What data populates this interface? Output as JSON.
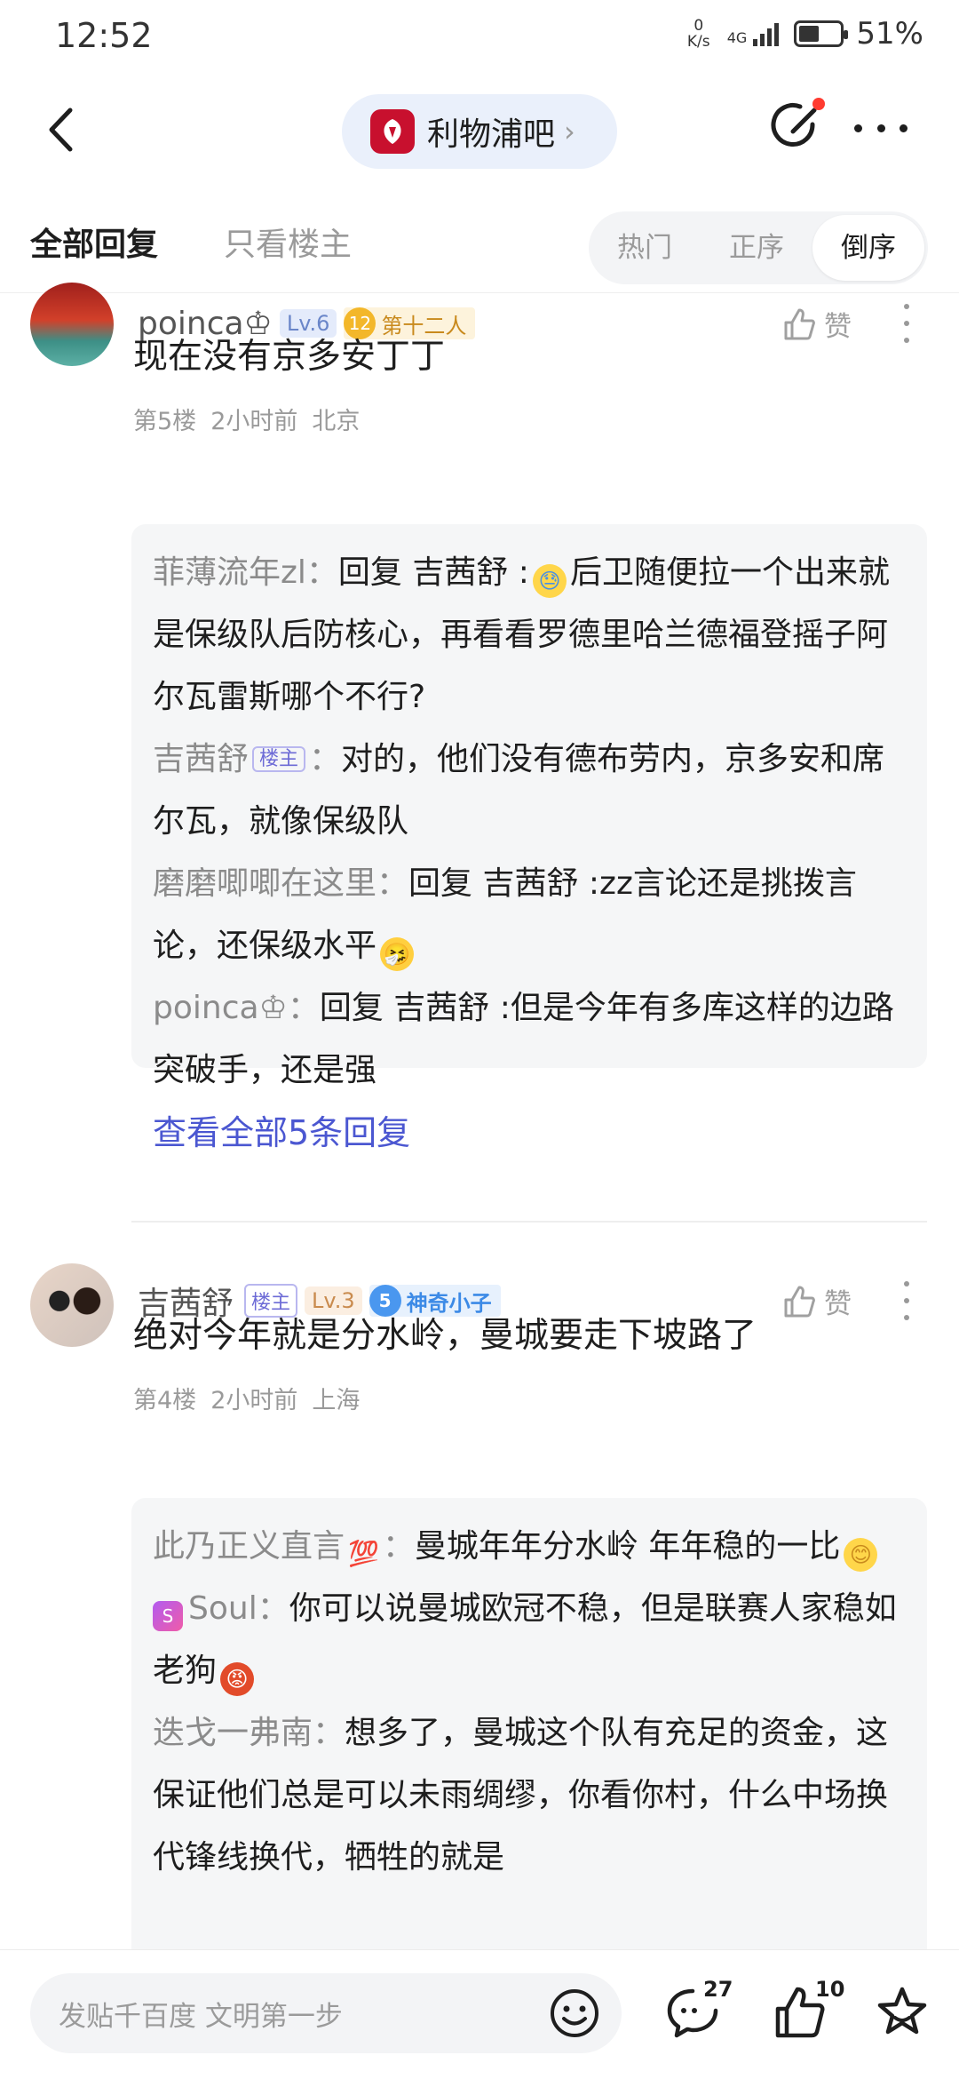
{
  "status_bar": {
    "time": "12:52",
    "net_speed_value": "0",
    "net_speed_unit": "K/s",
    "network": "4G",
    "battery_percent": "51%",
    "battery_level": 0.51
  },
  "header": {
    "forum_name": "利物浦吧",
    "forum_chevron": "›"
  },
  "tabs": {
    "all_replies": "全部回复",
    "only_op": "只看楼主",
    "sort": [
      "热门",
      "正序",
      "倒序"
    ],
    "active_sort": "倒序"
  },
  "posts": [
    {
      "username": "poinca♔",
      "level": "Lv.6",
      "title_badge_num": "12",
      "title_badge_text": "第十二人",
      "like_label": "赞",
      "content": "现在没有京多安丁丁",
      "floor": "第5楼",
      "time": "2小时前",
      "location": "北京",
      "replies": [
        {
          "name": "菲薄流年zl",
          "sep": "：",
          "text_before": "回复 吉茜舒 :",
          "emoji": "sweat-emoji",
          "text_after": "后卫随便拉一个出来就是保级队后防核心，再看看罗德里哈兰德福登摇子阿尔瓦雷斯哪个不行?"
        },
        {
          "name": "吉茜舒",
          "host_tag": "楼主",
          "sep": "：",
          "text_before": "对的，他们没有德布劳内，京多安和席尔瓦，就像保级队"
        },
        {
          "name": "磨磨唧唧在这里",
          "sep": "：",
          "text_before": "回复 吉茜舒 :zz言论还是挑拨言论，还保级水平",
          "emoji": "sneeze-emoji"
        },
        {
          "name": "poinca♔",
          "sep": "：",
          "text_before": "回复 吉茜舒 :但是今年有多库这样的边路突破手，还是强"
        }
      ],
      "view_all": "查看全部5条回复"
    },
    {
      "username": "吉茜舒",
      "host_tag": "楼主",
      "level": "Lv.3",
      "title_badge_num": "5",
      "title_badge_text": "神奇小子",
      "like_label": "赞",
      "content": "绝对今年就是分水岭，曼城要走下坡路了",
      "floor": "第4楼",
      "time": "2小时前",
      "location": "上海",
      "replies": [
        {
          "name": "此乃正义直言",
          "name_emoji": "💯",
          "sep": "：",
          "text_before": "曼城年年分水岭 年年稳的一比",
          "emoji": "smile-emoji"
        },
        {
          "name": "Soul",
          "soul_icon": "S",
          "sep": "：",
          "text_before": "你可以说曼城欧冠不稳，但是联赛人家稳如老狗",
          "emoji": "angry-emoji"
        },
        {
          "name": "迭戈一弗南",
          "sep": "：",
          "text_before": "想多了，曼城这个队有充足的资金，这保证他们总是可以未雨绸缪，你看你村，什么中场换代锋线换代，牺牲的就是"
        }
      ]
    }
  ],
  "bottom_bar": {
    "input_placeholder": "发贴千百度 文明第一步",
    "comment_count": "27",
    "like_count": "10"
  },
  "colors": {
    "accent_link": "#4b57d1",
    "forum_logo": "#c8102e",
    "host_tag": "#6d6bd6",
    "notification_dot": "#ff3b30"
  }
}
